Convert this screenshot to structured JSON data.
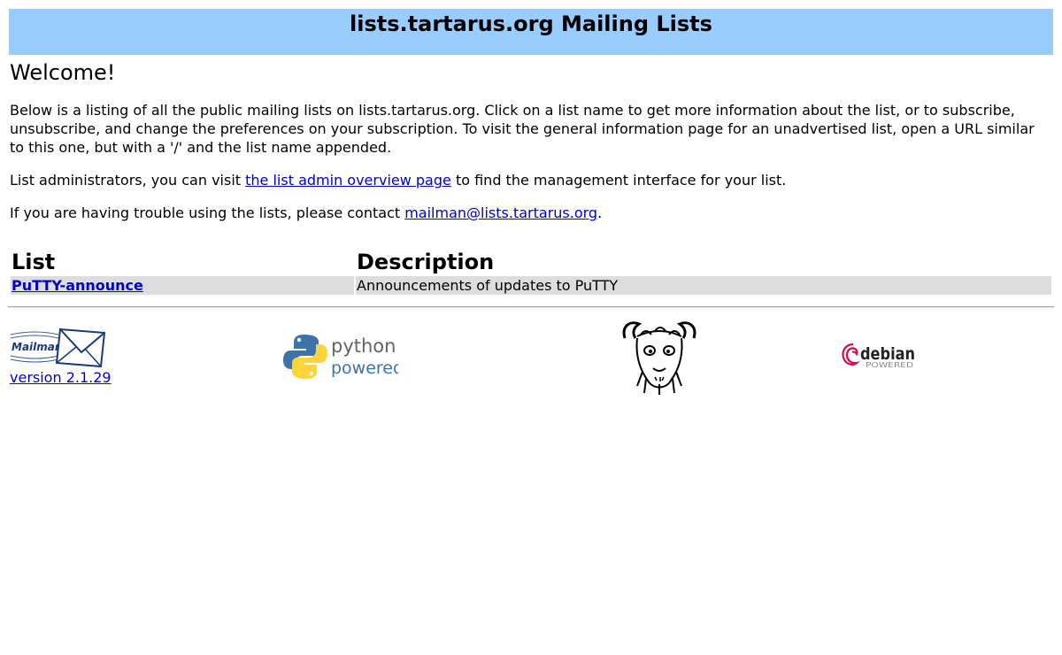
{
  "header": {
    "title": "lists.tartarus.org Mailing Lists"
  },
  "welcome": {
    "heading": "Welcome!"
  },
  "intro": {
    "text": "Below is a listing of all the public mailing lists on lists.tartarus.org. Click on a list name to get more information about the list, or to subscribe, unsubscribe, and change the preferences on your subscription. To visit the general information page for an unadvertised list, open a URL similar to this one, but with a '/' and the list name appended."
  },
  "admin": {
    "before": "List administrators, you can visit ",
    "link_text": "the list admin overview page",
    "after": " to find the management interface for your list."
  },
  "help": {
    "before": "If you are having trouble using the lists, please contact ",
    "link_text": "mailman@lists.tartarus.org",
    "after": "."
  },
  "lists_table": {
    "headers": [
      "List",
      "Description"
    ],
    "rows": [
      {
        "name": "PuTTY-announce",
        "description": "Announcements of updates to PuTTY"
      }
    ]
  },
  "footer": {
    "mailman_logo_text": "Mailman",
    "mailman_version": "version 2.1.29",
    "python_logo_words": [
      "python",
      "powered"
    ],
    "debian_logo_words": [
      "debian",
      "POWERED"
    ],
    "colors": {
      "banner": "#99ccff",
      "link": "#0000cc",
      "row_bg": "#dddddd",
      "python_blue": "#3d74a7",
      "python_yellow": "#ffd43b",
      "debian_red": "#d70751"
    },
    "icons": [
      "mailman-envelope-icon",
      "python-snake-icon",
      "gnu-head-icon",
      "debian-swirl-icon"
    ]
  }
}
